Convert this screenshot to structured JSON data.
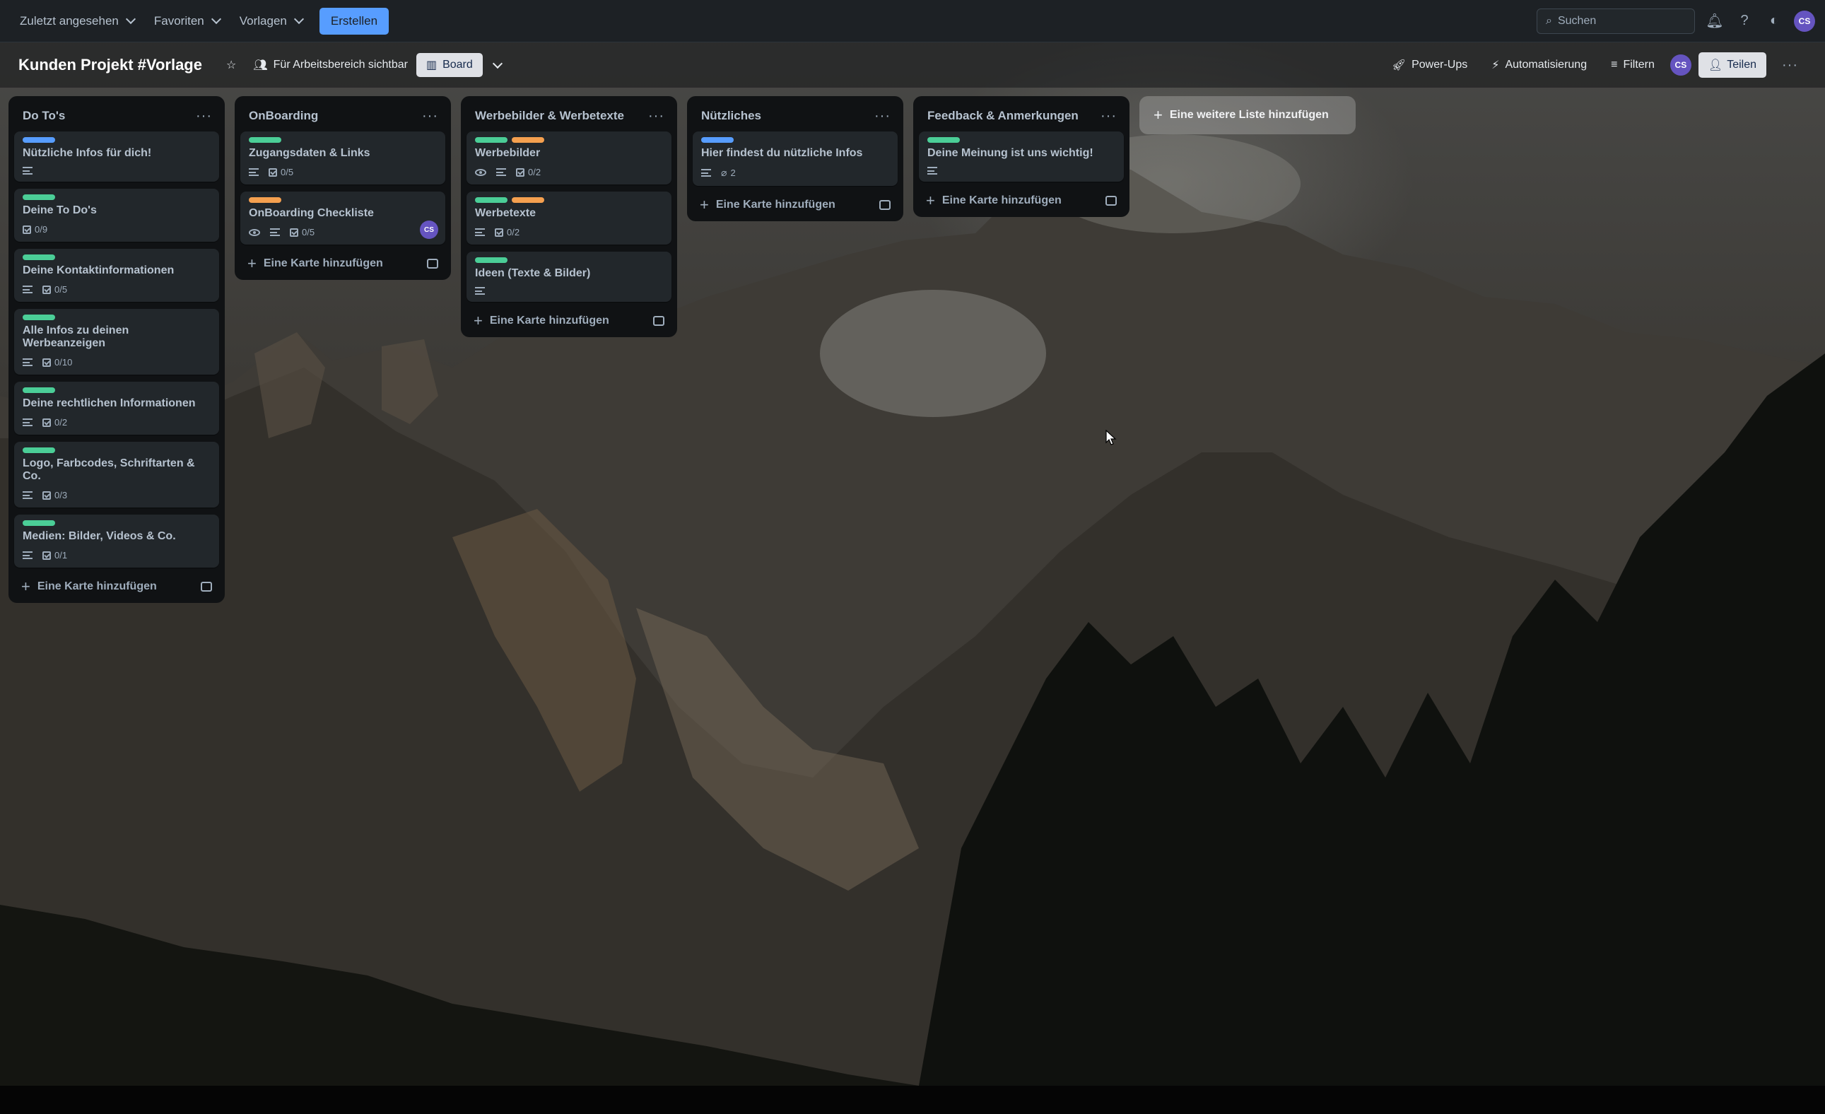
{
  "colors": {
    "label_blue": "#579dff",
    "label_green": "#4bce97",
    "label_orange": "#f5a04f",
    "create_button": "#579dff",
    "avatar_purple": "#6554c0"
  },
  "topnav": {
    "recent": "Zuletzt angesehen",
    "favorites": "Favoriten",
    "templates": "Vorlagen",
    "create": "Erstellen",
    "search_placeholder": "Suchen",
    "avatar_initials": "CS"
  },
  "board": {
    "title": "Kunden Projekt #Vorlage",
    "visibility": "Für Arbeitsbereich sichtbar",
    "view": "Board",
    "powerups": "Power-Ups",
    "automation": "Automatisierung",
    "filter": "Filtern",
    "share": "Teilen",
    "member_initials": "CS",
    "add_list": "Eine weitere Liste hinzufügen"
  },
  "lists": [
    {
      "title": "Do To's",
      "add_card": "Eine Karte hinzufügen",
      "cards": [
        {
          "title": "Nützliche Infos für dich!",
          "labels": [
            "blue"
          ],
          "desc": true,
          "checklist": ""
        },
        {
          "title": "Deine To Do's",
          "labels": [
            "green"
          ],
          "desc": false,
          "checklist": "0/9"
        },
        {
          "title": "Deine Kontaktinformationen",
          "labels": [
            "green"
          ],
          "desc": true,
          "checklist": "0/5"
        },
        {
          "title": "Alle Infos zu deinen Werbeanzeigen",
          "labels": [
            "green"
          ],
          "desc": true,
          "checklist": "0/10"
        },
        {
          "title": "Deine rechtlichen Informationen",
          "labels": [
            "green"
          ],
          "desc": true,
          "checklist": "0/2"
        },
        {
          "title": "Logo, Farbcodes, Schriftarten & Co.",
          "labels": [
            "green"
          ],
          "desc": true,
          "checklist": "0/3"
        },
        {
          "title": "Medien: Bilder, Videos & Co.",
          "labels": [
            "green"
          ],
          "desc": true,
          "checklist": "0/1"
        }
      ]
    },
    {
      "title": "OnBoarding",
      "add_card": "Eine Karte hinzufügen",
      "cards": [
        {
          "title": "Zugangsdaten & Links",
          "labels": [
            "green"
          ],
          "desc": true,
          "checklist": "0/5"
        },
        {
          "title": "OnBoarding Checkliste",
          "labels": [
            "orange"
          ],
          "watch": true,
          "desc": true,
          "checklist": "0/5",
          "avatar": "CS"
        }
      ]
    },
    {
      "title": "Werbebilder & Werbetexte",
      "add_card": "Eine Karte hinzufügen",
      "cards": [
        {
          "title": "Werbebilder",
          "labels": [
            "green",
            "orange"
          ],
          "watch": true,
          "desc": true,
          "checklist": "0/2"
        },
        {
          "title": "Werbetexte",
          "labels": [
            "green",
            "orange"
          ],
          "desc": true,
          "checklist": "0/2"
        },
        {
          "title": "Ideen (Texte & Bilder)",
          "labels": [
            "green"
          ],
          "desc": true,
          "checklist": ""
        }
      ]
    },
    {
      "title": "Nützliches",
      "add_card": "Eine Karte hinzufügen",
      "cards": [
        {
          "title": "Hier findest du nützliche Infos",
          "labels": [
            "blue"
          ],
          "desc": true,
          "attachments": "2"
        }
      ]
    },
    {
      "title": "Feedback & Anmerkungen",
      "add_card": "Eine Karte hinzufügen",
      "cards": [
        {
          "title": "Deine Meinung ist uns wichtig!",
          "labels": [
            "green"
          ],
          "desc": true,
          "checklist": ""
        }
      ]
    }
  ]
}
